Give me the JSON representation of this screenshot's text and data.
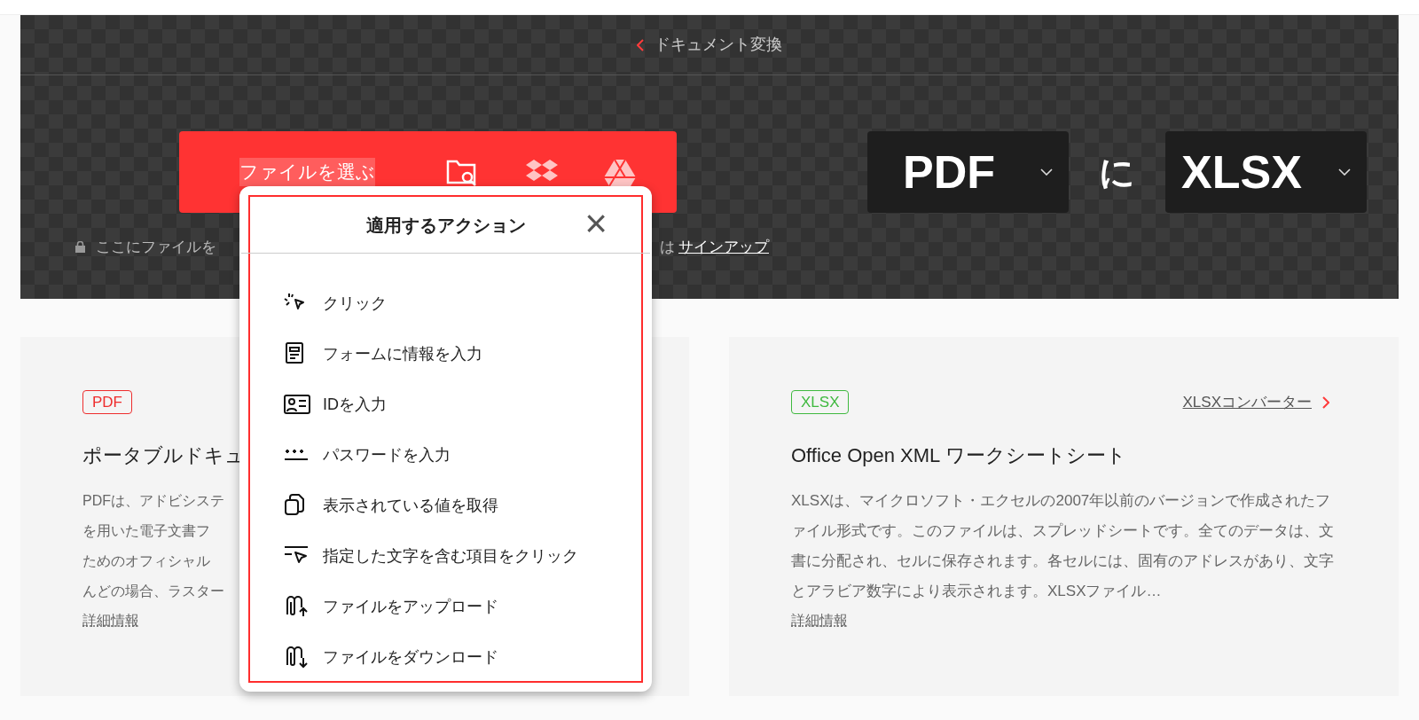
{
  "header": {
    "back_label": "ドキュメント変換"
  },
  "upload": {
    "button_label": "ファイルを選ぶ",
    "hint_visible_start": "ここにファイルを",
    "hint_visible_end": "は",
    "signup_link": "サインアップ"
  },
  "conversion": {
    "from": "PDF",
    "joiner": "に",
    "to": "XLSX"
  },
  "cards": [
    {
      "badge": "PDF",
      "color": "#ee2d2d",
      "title": "ポータブルドキュ",
      "lines": [
        "PDFは、アドビシステ",
        "を用いた電子文書フ",
        "ためのオフィシャル",
        "んどの場合、ラスター"
      ],
      "more": "詳細情報"
    },
    {
      "badge": "XLSX",
      "color": "#3fb93f",
      "link": "XLSXコンバーター",
      "title": "Office Open XML ワークシートシート",
      "description": "XLSXは、マイクロソフト・エクセルの2007年以前のバージョンで作成されたファイル形式です。このファイルは、スプレッドシートです。全てのデータは、文書に分配され、セルに保存されます。各セルには、固有のアドレスがあり、文字とアラビア数字により表示されます。XLSXファイル…",
      "more": "詳細情報"
    }
  ],
  "popup": {
    "title": "適用するアクション",
    "close": "×",
    "items": [
      {
        "kind": "click",
        "label": "クリック"
      },
      {
        "kind": "form",
        "label": "フォームに情報を入力"
      },
      {
        "kind": "id",
        "label": "IDを入力"
      },
      {
        "kind": "password",
        "label": "パスワードを入力"
      },
      {
        "kind": "copy",
        "label": "表示されている値を取得"
      },
      {
        "kind": "textclick",
        "label": "指定した文字を含む項目をクリック"
      },
      {
        "kind": "upload",
        "label": "ファイルをアップロード"
      },
      {
        "kind": "download",
        "label": "ファイルをダウンロード"
      }
    ]
  }
}
